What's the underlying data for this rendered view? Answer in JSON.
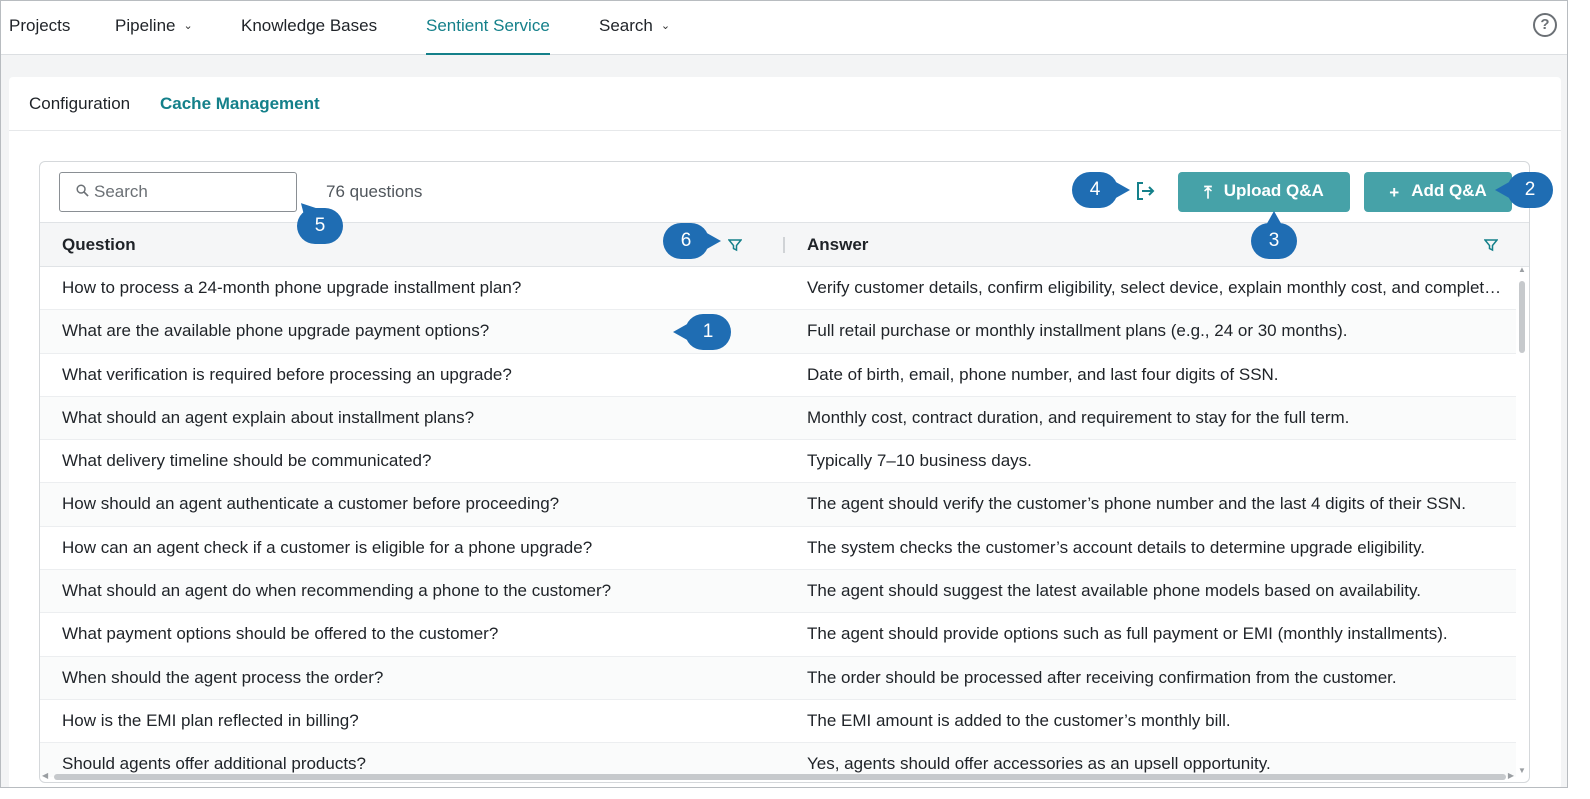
{
  "nav": {
    "items": [
      {
        "label": "Projects",
        "chevron": false,
        "active": false
      },
      {
        "label": "Pipeline",
        "chevron": true,
        "active": false
      },
      {
        "label": "Knowledge Bases",
        "chevron": false,
        "active": false
      },
      {
        "label": "Sentient Service",
        "chevron": false,
        "active": true
      },
      {
        "label": "Search",
        "chevron": true,
        "active": false
      }
    ],
    "help_icon": "question-circle-icon",
    "help_glyph": "?"
  },
  "subtabs": {
    "configuration": "Configuration",
    "cache_management": "Cache Management"
  },
  "toolbar": {
    "search_placeholder": "Search",
    "question_count": "76 questions",
    "upload_label": "Upload Q&A",
    "add_label": "Add Q&A",
    "upload_glyph": "⤒",
    "add_glyph": "+"
  },
  "table": {
    "columns": {
      "question": "Question",
      "answer": "Answer"
    },
    "rows": [
      {
        "q": "How to process a 24-month phone upgrade installment plan?",
        "a": "Verify customer details, confirm eligibility, select device, explain monthly cost, and complete the order."
      },
      {
        "q": "What are the available phone upgrade payment options?",
        "a": "Full retail purchase or monthly installment plans (e.g., 24 or 30 months)."
      },
      {
        "q": "What verification is required before processing an upgrade?",
        "a": "Date of birth, email, phone number, and last four digits of SSN."
      },
      {
        "q": "What should an agent explain about installment plans?",
        "a": "Monthly cost, contract duration, and requirement to stay for the full term."
      },
      {
        "q": "What delivery timeline should be communicated?",
        "a": "Typically 7–10 business days."
      },
      {
        "q": "How should an agent authenticate a customer before proceeding?",
        "a": "The agent should verify the customer’s phone number and the last 4 digits of their SSN."
      },
      {
        "q": "How can an agent check if a customer is eligible for a phone upgrade?",
        "a": "The system checks the customer’s account details to determine upgrade eligibility."
      },
      {
        "q": "What should an agent do when recommending a phone to the customer?",
        "a": "The agent should suggest the latest available phone models based on availability."
      },
      {
        "q": "What payment options should be offered to the customer?",
        "a": "The agent should provide options such as full payment or EMI (monthly installments)."
      },
      {
        "q": "When should the agent process the order?",
        "a": "The order should be processed after receiving confirmation from the customer."
      },
      {
        "q": "How is the EMI plan reflected in billing?",
        "a": "The EMI amount is added to the customer’s monthly bill."
      },
      {
        "q": "Should agents offer additional products?",
        "a": "Yes, agents should offer accessories as an upsell opportunity."
      }
    ]
  },
  "callouts": [
    "1",
    "2",
    "3",
    "4",
    "5",
    "6"
  ],
  "colors": {
    "accent": "#14808a",
    "button": "#46a2a8",
    "callout": "#1f6db3"
  }
}
